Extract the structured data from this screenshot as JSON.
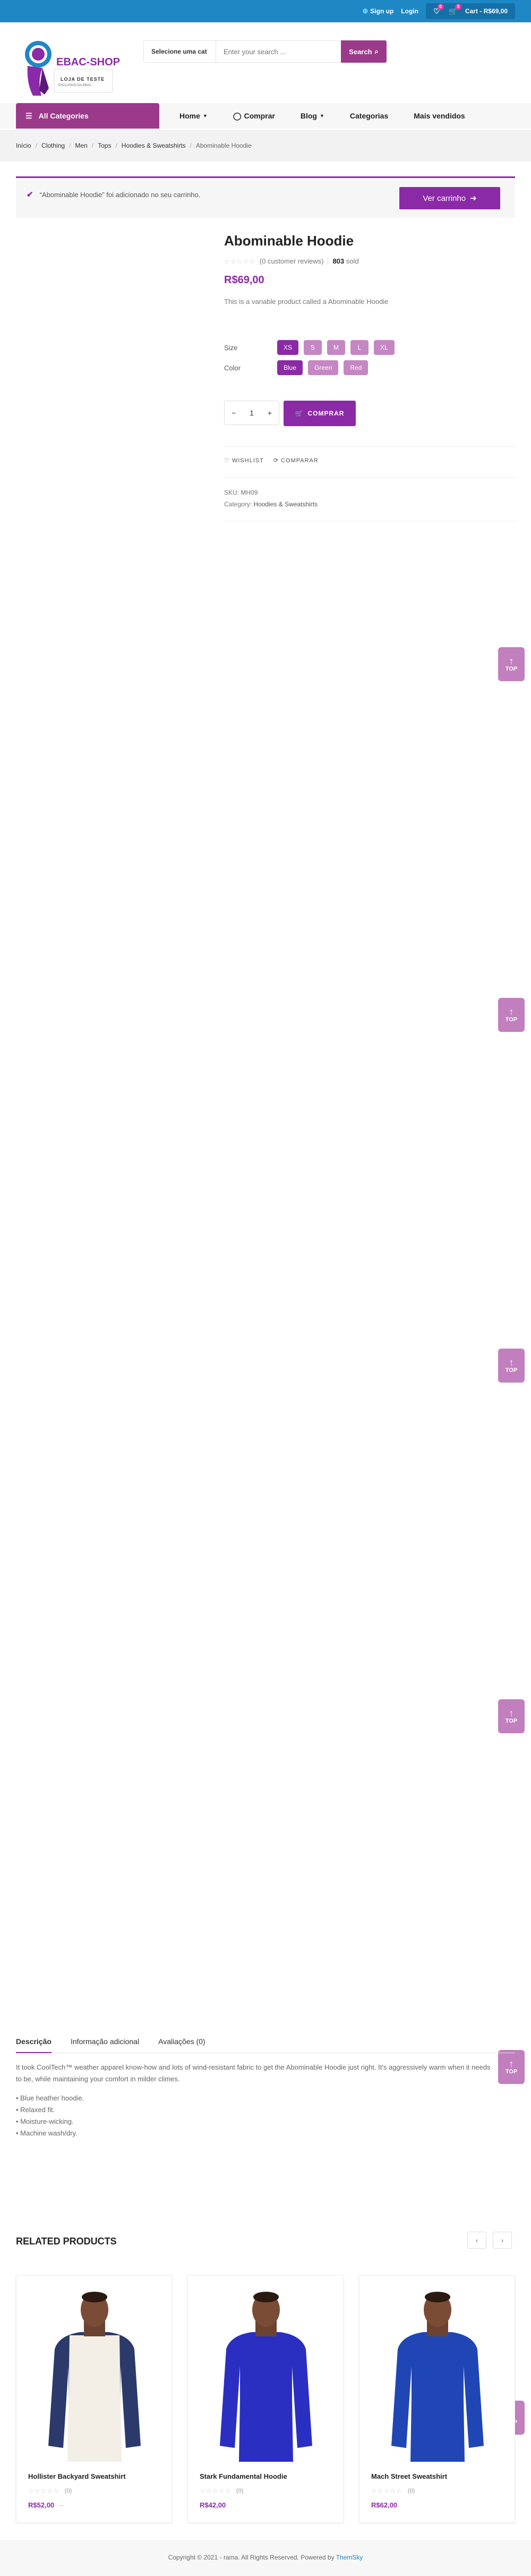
{
  "topbar": {
    "signup": "Sign up",
    "login": "Login",
    "wishlist_count": "0",
    "cart_count": "0",
    "cart_label": "Cart - R$69,00"
  },
  "header": {
    "logo_title": "EBAC-SHOP",
    "logo_subtitle": "LOJA DE TESTE",
    "logo_tagline": "EXCLUSIVO DA EBAC",
    "search_category": "Selecione uma cat",
    "search_placeholder": "Enter your search ...",
    "search_button": "Search"
  },
  "nav": {
    "all_categories": "All Categories",
    "items": [
      "Home",
      "Comprar",
      "Blog",
      "Categorias",
      "Mais vendidos"
    ]
  },
  "breadcrumb": [
    "Início",
    "Clothing",
    "Men",
    "Tops",
    "Hoodies & Sweatshirts",
    "Abominable Hoodie"
  ],
  "notice": {
    "text": "“Abominable Hoodie” foi adicionado no seu carrinho.",
    "button": "Ver carrinho"
  },
  "product": {
    "title": "Abominable Hoodie",
    "reviews": "(0 customer reviews)",
    "sold_count": "803",
    "sold_label": "sold",
    "price": "R$69,00",
    "short_description": "This is a variable product called a Abominable Hoodie",
    "size_label": "Size",
    "sizes": [
      "XS",
      "S",
      "M",
      "L",
      "XL"
    ],
    "selected_size": "XS",
    "color_label": "Color",
    "colors": [
      "Blue",
      "Green",
      "Red"
    ],
    "selected_color": "Blue",
    "quantity": "1",
    "buy_button": "COMPRAR",
    "wishlist": "WISHLIST",
    "compare": "COMPARAR",
    "sku_label": "SKU:",
    "sku": "MH09",
    "category_label": "Category:",
    "category": "Hoodies & Sweatshirts"
  },
  "to_top_label": "TOP",
  "tabs": [
    "Descrição",
    "Informação adicional",
    "Avaliações (0)"
  ],
  "description": {
    "text": "It took CoolTech™ weather apparel know-how and lots of wind-resistant fabric to get the Abominable Hoodie just right. It's aggressively warm when it needs to be, while maintaining your comfort in milder climes.",
    "bullets": [
      "Blue heather hoodie.",
      "Relaxed fit.",
      "Moisture-wicking.",
      "Machine wash/dry."
    ]
  },
  "related": {
    "title": "RELATED PRODUCTS",
    "items": [
      {
        "name": "Hollister Backyard Sweatshirt",
        "rating_count": "(0)",
        "price": "R$52,00",
        "old_price": "–",
        "shirt_color": "#f3eee6",
        "sleeve_color": "#2b3a6b"
      },
      {
        "name": "Stark Fundamental Hoodie",
        "rating_count": "(0)",
        "price": "R$42,00",
        "old_price": "",
        "shirt_color": "#2a2fc2",
        "sleeve_color": "#2a2fc2"
      },
      {
        "name": "Mach Street Sweatshirt",
        "rating_count": "(0)",
        "price": "R$62,00",
        "old_price": "",
        "shirt_color": "#1f46b4",
        "sleeve_color": "#1f46b4"
      }
    ]
  },
  "footer": {
    "text": "Copyright © 2021 - rama. All Rights Reserved. Powered by",
    "brand": "ThemSky"
  },
  "colors": {
    "topbar": "#1e88c5",
    "accent": "#8b2aa6",
    "swatch": "#c586c4"
  }
}
